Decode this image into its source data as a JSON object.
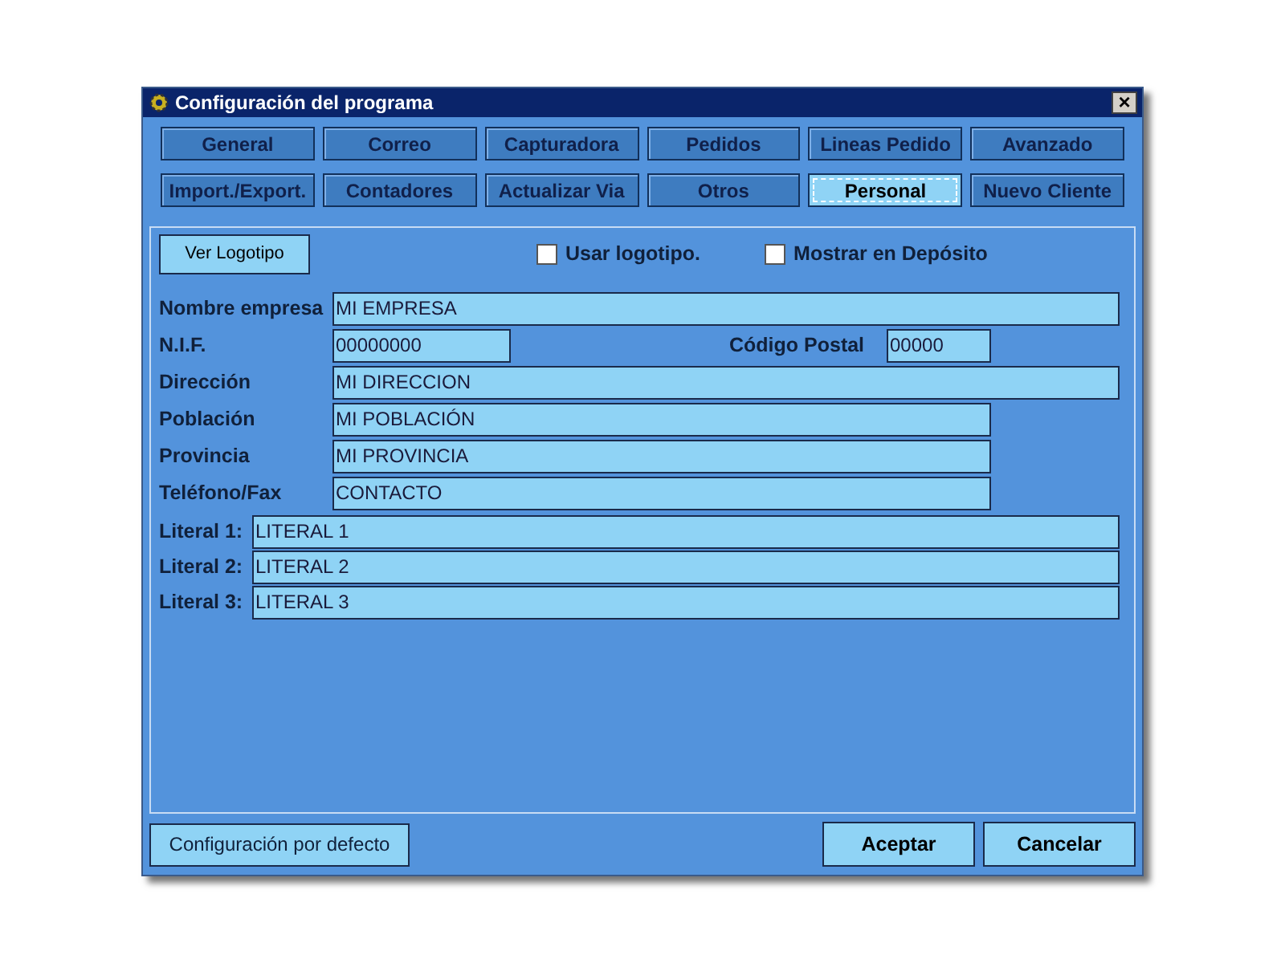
{
  "window": {
    "title": "Configuración del programa",
    "close": "×"
  },
  "tabs": [
    {
      "label": "General",
      "selected": false
    },
    {
      "label": "Correo",
      "selected": false
    },
    {
      "label": "Capturadora",
      "selected": false
    },
    {
      "label": "Pedidos",
      "selected": false
    },
    {
      "label": "Lineas Pedido",
      "selected": false
    },
    {
      "label": "Avanzado",
      "selected": false
    },
    {
      "label": "Import./Export.",
      "selected": false
    },
    {
      "label": "Contadores",
      "selected": false
    },
    {
      "label": "Actualizar Via",
      "selected": false
    },
    {
      "label": "Otros",
      "selected": false
    },
    {
      "label": "Personal",
      "selected": true
    },
    {
      "label": "Nuevo Cliente",
      "selected": false
    }
  ],
  "logo_button": "Ver Logotipo",
  "checkboxes": [
    {
      "label": "Usar logotipo.",
      "checked": false
    },
    {
      "label": "Mostrar en Depósito",
      "checked": false
    }
  ],
  "fields": [
    {
      "kind": "full",
      "label": "Nombre empresa",
      "value": "MI EMPRESA"
    },
    {
      "kind": "pair",
      "label": "N.I.F.",
      "value": "00000000",
      "label_2": "Código Postal",
      "value_2": "00000"
    },
    {
      "kind": "full",
      "label": "Dirección",
      "value": "MI DIRECCION"
    },
    {
      "kind": "medium",
      "label": "Población",
      "value": "MI POBLACIÓN"
    },
    {
      "kind": "medium",
      "label": "Provincia",
      "value": "MI PROVINCIA"
    },
    {
      "kind": "medium",
      "label": "Teléfono/Fax",
      "value": "CONTACTO"
    }
  ],
  "literals": [
    {
      "label": "Literal 1:",
      "value": "LITERAL 1"
    },
    {
      "label": "Literal 2:",
      "value": "LITERAL 2"
    },
    {
      "label": "Literal 3:",
      "value": "LITERAL 3"
    }
  ],
  "buttons": {
    "defaults": "Configuración por defecto",
    "ok": "Aceptar",
    "cancel": "Cancelar"
  }
}
